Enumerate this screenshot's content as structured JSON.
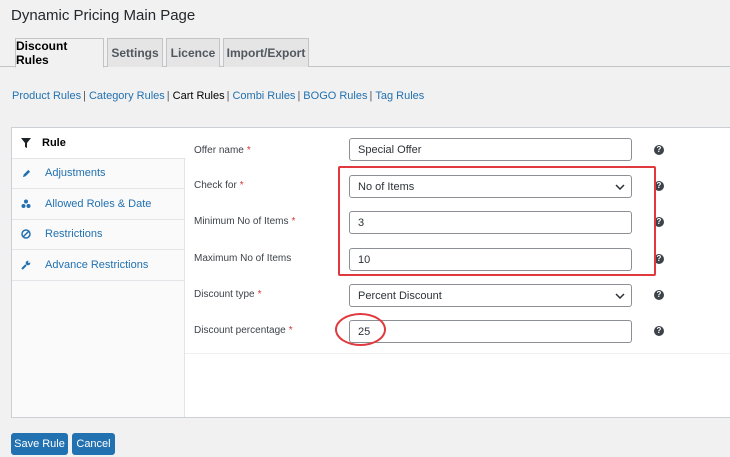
{
  "page": {
    "title": "Dynamic Pricing Main Page"
  },
  "tabs": [
    {
      "label": "Discount Rules",
      "active": true
    },
    {
      "label": "Settings"
    },
    {
      "label": "Licence"
    },
    {
      "label": "Import/Export"
    }
  ],
  "subnav": [
    {
      "label": "Product Rules"
    },
    {
      "label": "Category Rules"
    },
    {
      "label": "Cart Rules",
      "current": true
    },
    {
      "label": "Combi Rules"
    },
    {
      "label": "BOGO Rules"
    },
    {
      "label": "Tag Rules"
    }
  ],
  "sidebar": [
    {
      "label": "Rule",
      "icon": "filter-icon",
      "active": true
    },
    {
      "label": "Adjustments",
      "icon": "pencil-icon"
    },
    {
      "label": "Allowed Roles & Date",
      "icon": "users-icon"
    },
    {
      "label": "Restrictions",
      "icon": "block-icon"
    },
    {
      "label": "Advance Restrictions",
      "icon": "wrench-icon"
    }
  ],
  "form": {
    "offer_name": {
      "label": "Offer name",
      "required": "*",
      "value": "Special Offer"
    },
    "check_for": {
      "label": "Check for",
      "required": "*",
      "value": "No of Items"
    },
    "min_items": {
      "label": "Minimum No of Items",
      "required": "*",
      "value": "3"
    },
    "max_items": {
      "label": "Maximum No of Items",
      "value": "10"
    },
    "discount_type": {
      "label": "Discount type",
      "required": "*",
      "value": "Percent Discount"
    },
    "discount_pct": {
      "label": "Discount percentage",
      "required": "*",
      "value": "25"
    },
    "help_glyph": "?"
  },
  "buttons": {
    "save": "Save Rule",
    "cancel": "Cancel"
  },
  "colors": {
    "accent": "#2271b1",
    "highlight": "#e0393e"
  }
}
